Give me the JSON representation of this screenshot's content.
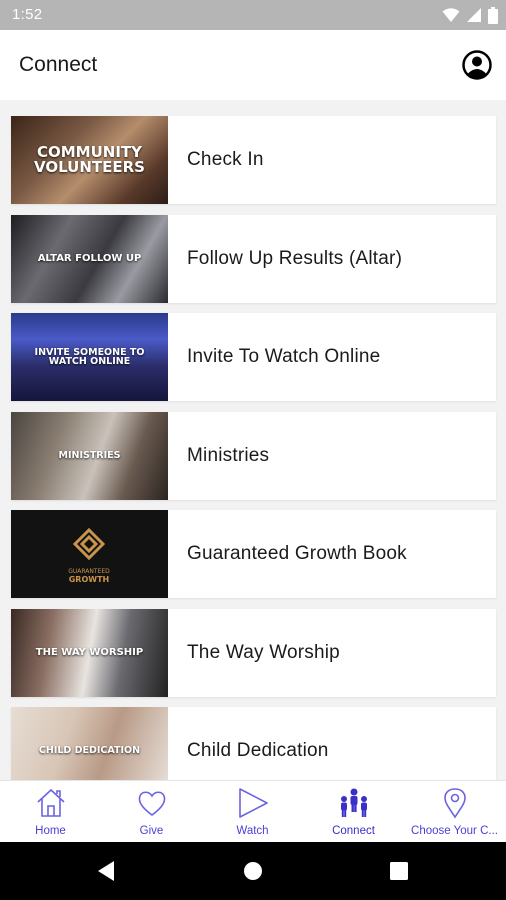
{
  "status_bar": {
    "time": "1:52",
    "icons": [
      "wifi-icon",
      "cellular-icon",
      "battery-icon"
    ]
  },
  "app_bar": {
    "title": "Connect",
    "profile_icon": "account-circle-icon"
  },
  "items": [
    {
      "label": "Check In",
      "thumb_text": "COMMUNITY VOLUNTEERS"
    },
    {
      "label": "Follow Up Results (Altar)",
      "thumb_text": "ALTAR FOLLOW UP"
    },
    {
      "label": "Invite To Watch Online",
      "thumb_text": "INVITE SOMEONE TO WATCH ONLINE"
    },
    {
      "label": "Ministries",
      "thumb_text": "MINISTRIES"
    },
    {
      "label": "Guaranteed Growth Book",
      "thumb_text": "GUARANTEED GROWTH"
    },
    {
      "label": "The Way Worship",
      "thumb_text": "THE WAY WORSHIP"
    },
    {
      "label": "Child Dedication",
      "thumb_text": "CHILD DEDICATION"
    }
  ],
  "bottom_nav": [
    {
      "label": "Home",
      "icon": "home-icon"
    },
    {
      "label": "Give",
      "icon": "heart-icon"
    },
    {
      "label": "Watch",
      "icon": "play-icon"
    },
    {
      "label": "Connect",
      "icon": "people-icon",
      "active": true
    },
    {
      "label": "Choose Your C...",
      "icon": "location-pin-icon"
    }
  ],
  "colors": {
    "accent": "#4b3fd6",
    "status_bar": "#b5b5b5",
    "background": "#f2f2f2"
  }
}
